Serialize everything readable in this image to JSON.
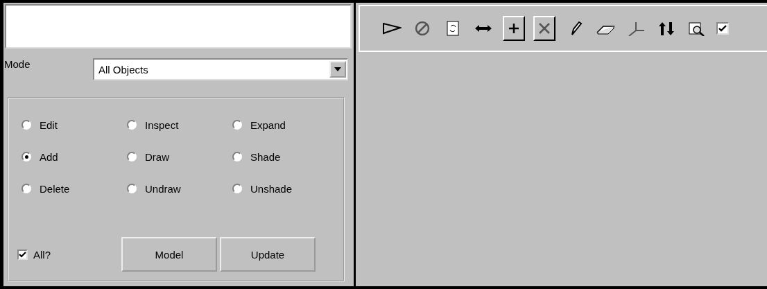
{
  "mode": {
    "label": "Mode",
    "value": "All Objects"
  },
  "options": [
    {
      "label": "Edit",
      "selected": false
    },
    {
      "label": "Inspect",
      "selected": false
    },
    {
      "label": "Expand",
      "selected": false
    },
    {
      "label": "Add",
      "selected": true
    },
    {
      "label": "Draw",
      "selected": false
    },
    {
      "label": "Shade",
      "selected": false
    },
    {
      "label": "Delete",
      "selected": false
    },
    {
      "label": "Undraw",
      "selected": false
    },
    {
      "label": "Unshade",
      "selected": false
    }
  ],
  "all_checkbox": {
    "label": "All?",
    "checked": true
  },
  "buttons": [
    "Model",
    "Update"
  ],
  "toolbar": [
    {
      "kind": "plain"
    },
    {
      "kind": "plain"
    },
    {
      "kind": "plain"
    },
    {
      "kind": "plain"
    },
    {
      "kind": "framed"
    },
    {
      "kind": "framed"
    },
    {
      "kind": "plain"
    },
    {
      "kind": "plain"
    },
    {
      "kind": "plain"
    },
    {
      "kind": "plain"
    },
    {
      "kind": "plain"
    },
    {
      "kind": "check",
      "checked": true
    }
  ]
}
